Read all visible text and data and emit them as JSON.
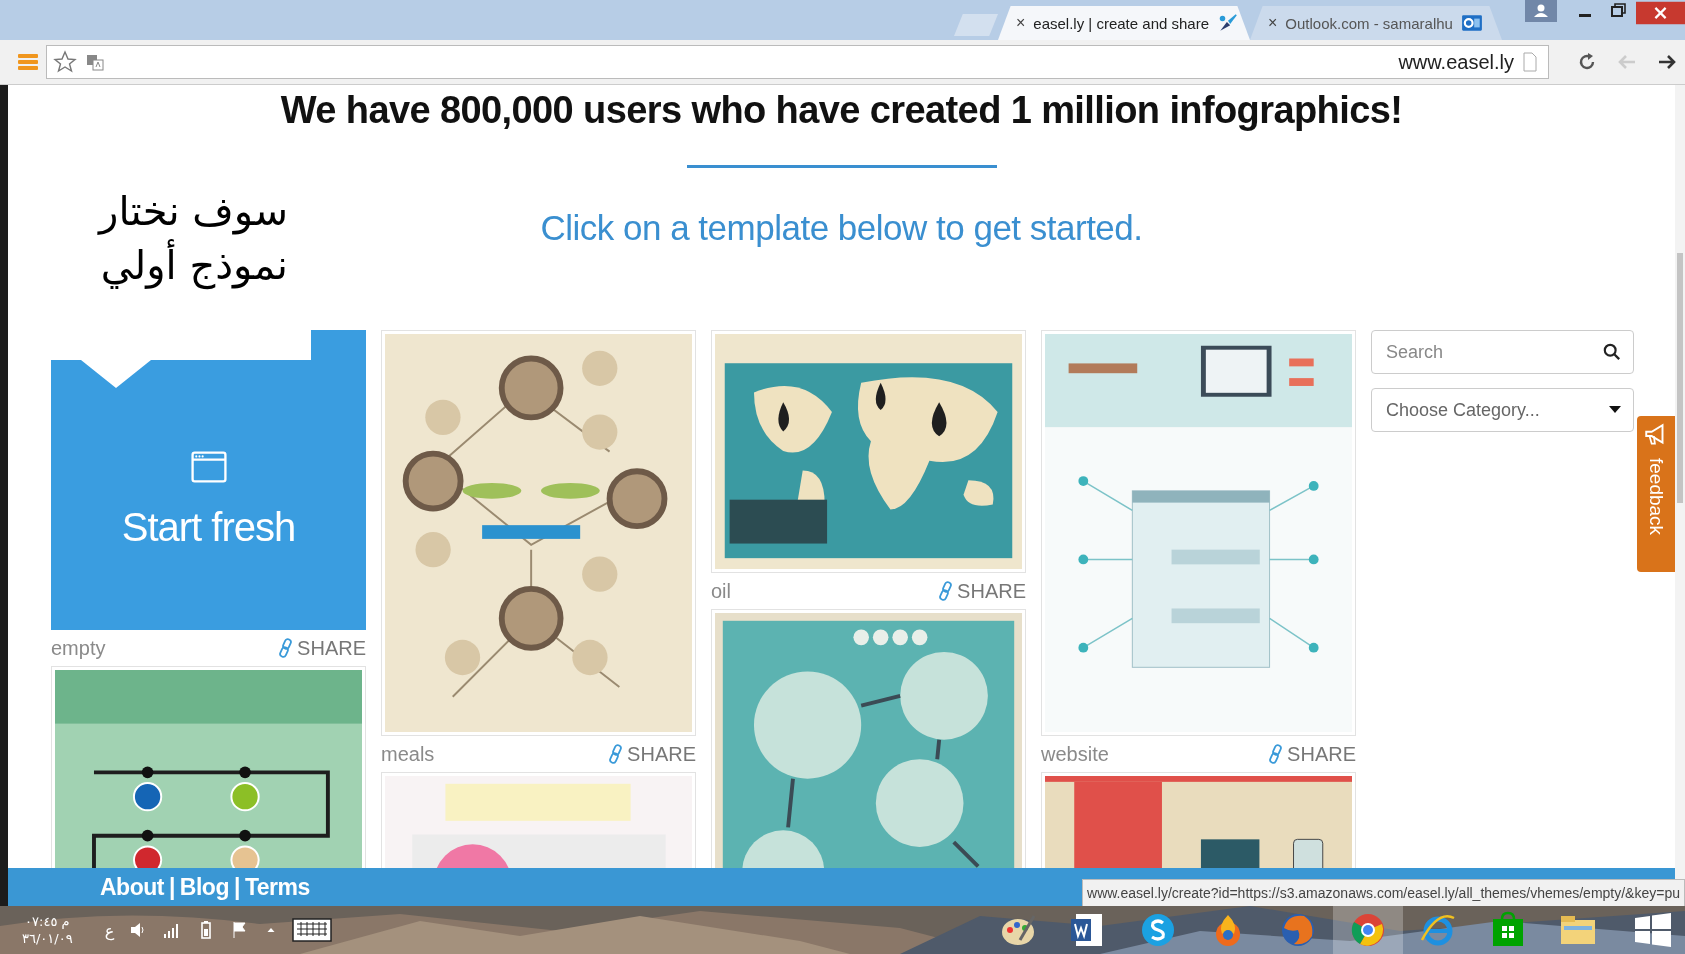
{
  "browser": {
    "tabs": [
      {
        "label": "easel.ly | create and share",
        "close": "×",
        "selected": true
      },
      {
        "label": "Outlook.com - samaralhu",
        "close": "×",
        "selected": false
      }
    ],
    "url": "www.easel.ly"
  },
  "page": {
    "headline": "We have 800,000 users who have created 1 million infographics!",
    "annotation": [
      "سوف نختار",
      "نموذج أولي"
    ],
    "subheading": "Click on a template below to get started.",
    "columns": [
      [
        {
          "kind": "start",
          "title": "Start fresh",
          "label": "empty",
          "share": "SHARE"
        },
        {
          "kind": "picture"
        }
      ],
      [
        {
          "kind": "template",
          "label": "meals",
          "share": "SHARE"
        },
        {
          "kind": "picture"
        }
      ],
      [
        {
          "kind": "template",
          "label": "oil",
          "share": "SHARE"
        },
        {
          "kind": "picture"
        }
      ],
      [
        {
          "kind": "template",
          "label": "website",
          "share": "SHARE"
        },
        {
          "kind": "picture"
        }
      ]
    ],
    "search": {
      "placeholder": "Search"
    },
    "category": {
      "placeholder": "Choose Category..."
    },
    "feedback": "feedback",
    "footer": {
      "links": [
        "About",
        "Blog",
        "Terms"
      ],
      "separator": "|"
    },
    "status_url": "www.easel.ly/create?id=https://s3.amazonaws.com/easel.ly/all_themes/vhemes/empty/&key=pu"
  },
  "taskbar": {
    "time": "م ٠٧:٤٥",
    "date": "٣٦/٠١/٠٩",
    "language": "ع"
  }
}
